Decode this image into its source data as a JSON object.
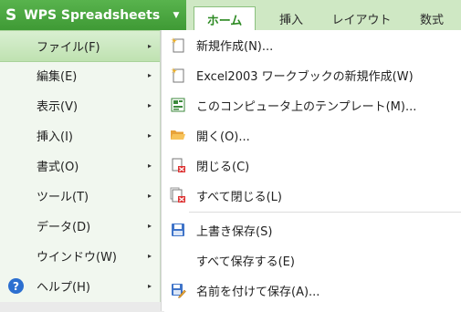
{
  "app": {
    "logo_letter": "S",
    "title": "WPS Spreadsheets",
    "caret": "▼"
  },
  "tabs": [
    {
      "label": "ホーム",
      "active": true
    },
    {
      "label": "挿入",
      "active": false
    },
    {
      "label": "レイアウト",
      "active": false
    },
    {
      "label": "数式",
      "active": false
    }
  ],
  "left_menu": {
    "items": [
      {
        "label": "ファイル(F)",
        "selected": true
      },
      {
        "label": "編集(E)"
      },
      {
        "label": "表示(V)"
      },
      {
        "label": "挿入(I)"
      },
      {
        "label": "書式(O)"
      },
      {
        "label": "ツール(T)"
      },
      {
        "label": "データ(D)"
      },
      {
        "label": "ウインドウ(W)"
      },
      {
        "label": "ヘルプ(H)",
        "icon": "help-icon"
      }
    ],
    "help_glyph": "?",
    "arrow": "▸"
  },
  "submenu": {
    "items": [
      {
        "label": "新規作成(N)...",
        "icon": "new-file-icon"
      },
      {
        "label": "Excel2003 ワークブックの新規作成(W)",
        "icon": "new-workbook-icon"
      },
      {
        "label": "このコンピュータ上のテンプレート(M)...",
        "icon": "template-icon"
      },
      {
        "label": "開く(O)...",
        "icon": "open-folder-icon"
      },
      {
        "label": "閉じる(C)",
        "icon": "close-document-icon"
      },
      {
        "label": "すべて閉じる(L)",
        "icon": "close-all-icon"
      },
      {
        "label": "上書き保存(S)",
        "icon": "save-icon"
      },
      {
        "label": "すべて保存する(E)",
        "icon": ""
      },
      {
        "label": "名前を付けて保存(A)...",
        "icon": "save-as-icon"
      }
    ]
  },
  "colors": {
    "brand_green": "#4aa63f",
    "tab_bar": "#cfe8c4",
    "active_tab_text": "#2d8a23"
  }
}
